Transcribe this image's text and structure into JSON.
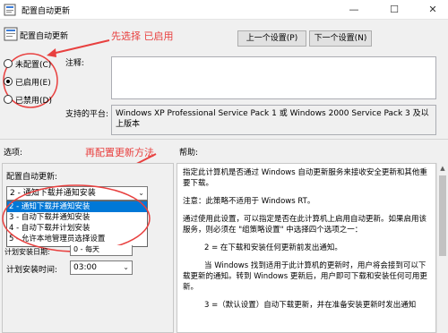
{
  "window": {
    "title": "配置自动更新",
    "controls": {
      "minimize": "—",
      "maximize": "☐",
      "close": "✕"
    }
  },
  "header": {
    "policy_name": "配置自动更新",
    "prev_button": "上一个设置(P)",
    "next_button": "下一个设置(N)"
  },
  "annotations": {
    "top": "先选择 已启用",
    "middle": "再配置更新方法"
  },
  "state": {
    "options": [
      {
        "label": "未配置(C)",
        "selected": false
      },
      {
        "label": "已启用(E)",
        "selected": true
      },
      {
        "label": "已禁用(D)",
        "selected": false
      }
    ]
  },
  "comment": {
    "label": "注释:",
    "value": ""
  },
  "supported": {
    "label": "支持的平台:",
    "value": "Windows XP Professional Service Pack 1 或 Windows 2000 Service Pack 3 及以上版本"
  },
  "sections": {
    "options_label": "选项:",
    "help_label": "帮助:"
  },
  "config": {
    "label": "配置自动更新:",
    "selected": "2 - 通知下载并通知安装",
    "dropdown_items": [
      "2 - 通知下载并通知安装",
      "3 - 自动下载并通知安装",
      "4 - 自动下载并计划安装",
      "5 - 允许本地管理员选择设置"
    ],
    "schedule_day_label": "计划安装日期:",
    "schedule_day_value": "0 - 每天",
    "schedule_time_label": "计划安装时间:",
    "schedule_time_value": "03:00"
  },
  "help": {
    "paragraphs": [
      "指定此计算机是否通过 Windows 自动更新服务来接收安全更新和其他重要下载。",
      "注意：此策略不适用于 Windows RT。",
      "通过使用此设置，可以指定是否在此计算机上启用自动更新。如果启用该服务，则必须在 \"组策略设置\" 中选择四个选项之一：",
      "2 = 在下载和安装任何更新前发出通知。",
      "当 Windows 找到适用于此计算机的更新时，用户将会接到可以下载更新的通知。转到 Windows 更新后，用户即可下载和安装任何可用更新。",
      "3 =（默认设置）自动下载更新，并在准备安装更新时发出通知"
    ]
  },
  "colors": {
    "annotation_red": "#e8403f",
    "selection_blue": "#0078d7"
  }
}
